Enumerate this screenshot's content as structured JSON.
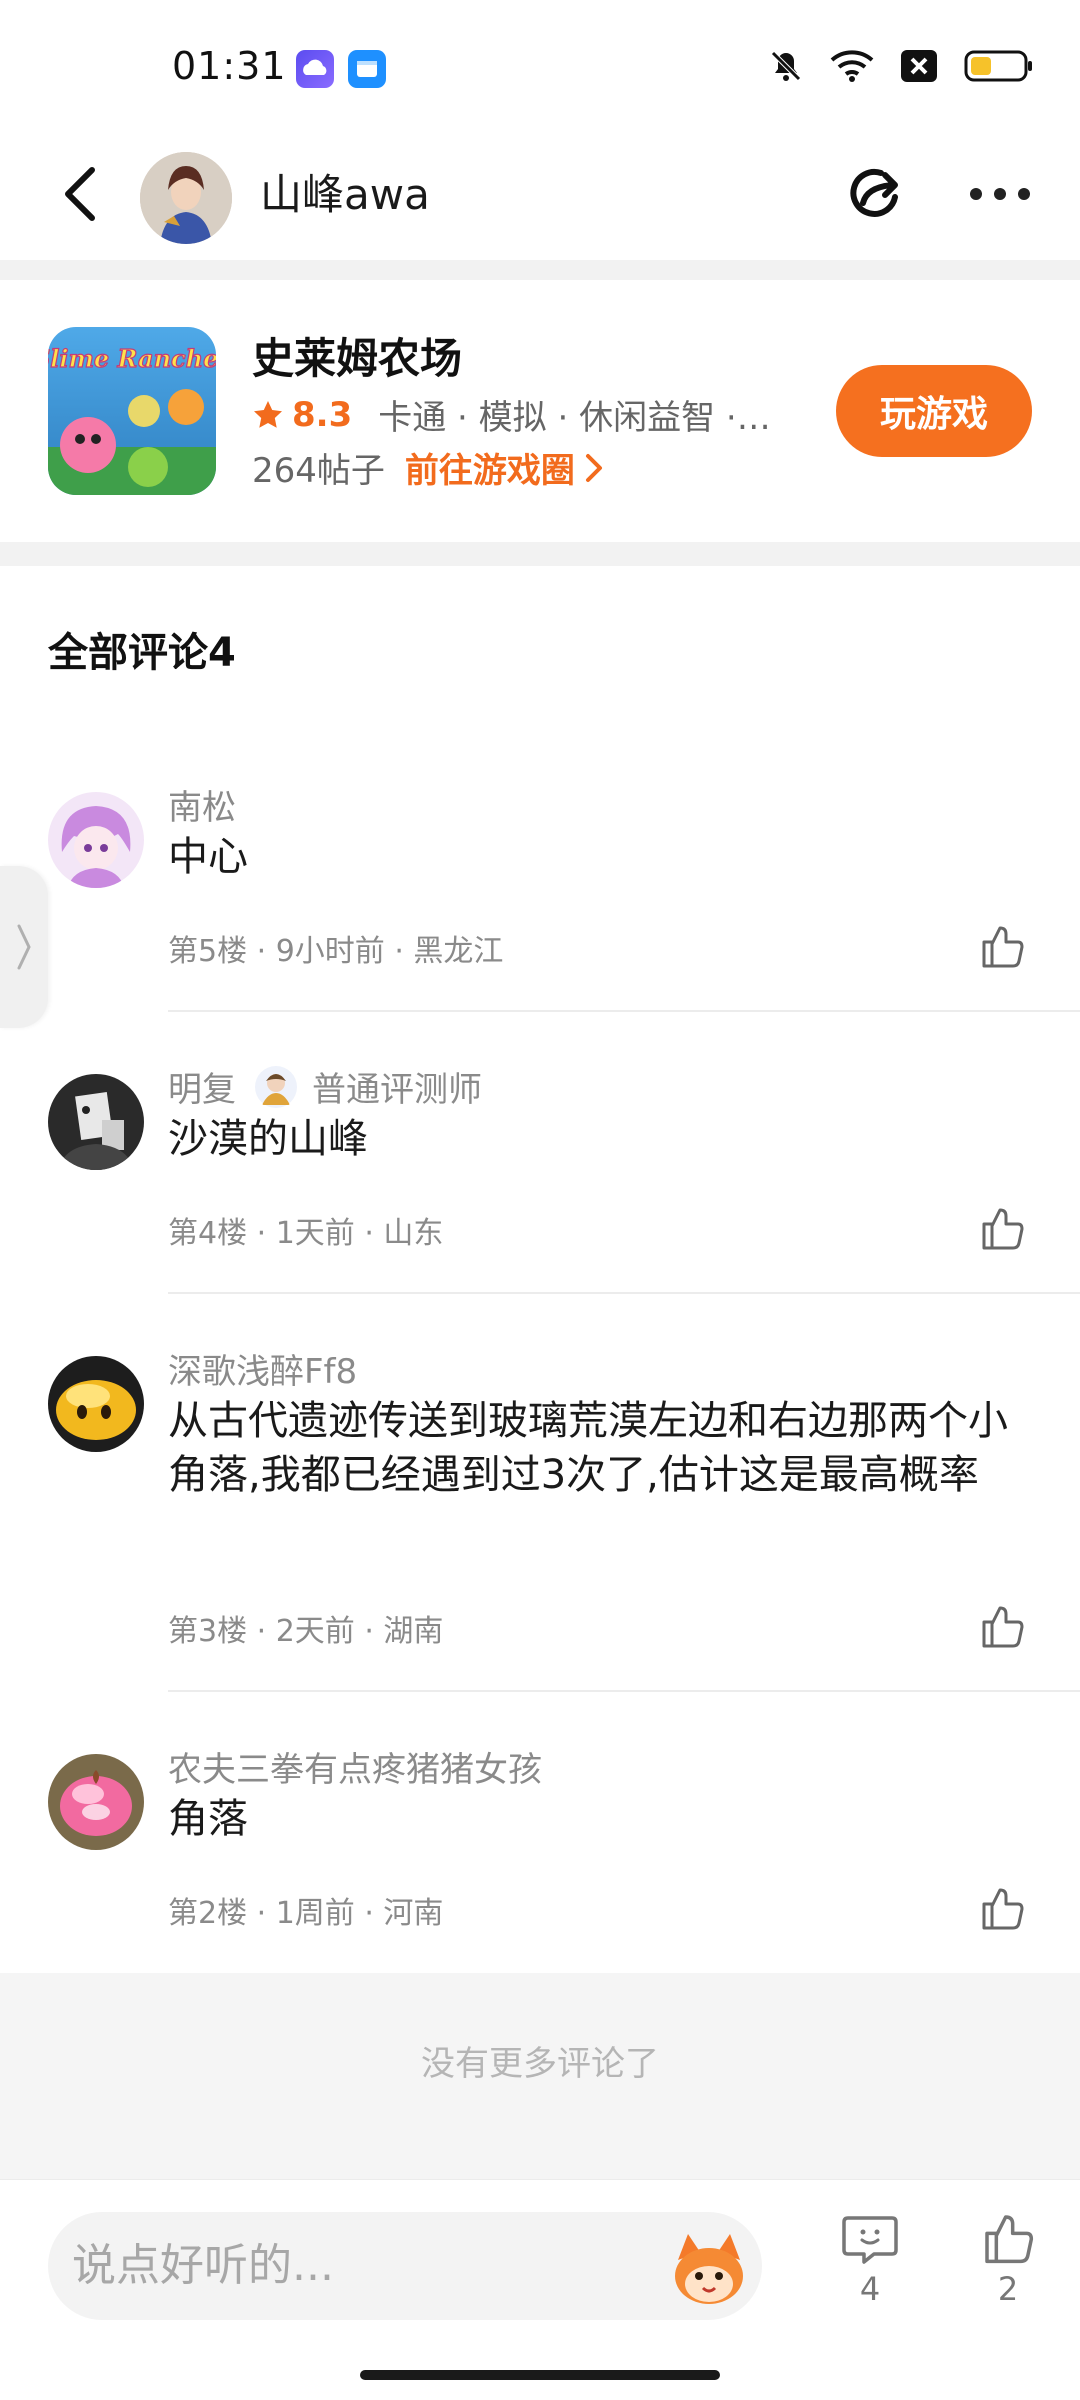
{
  "status_bar": {
    "time": "01:31",
    "icons": [
      "cloud-app-icon",
      "files-app-icon",
      "mute-icon",
      "wifi-icon",
      "close-box-icon",
      "battery-icon"
    ]
  },
  "header": {
    "username": "山峰awa",
    "icons": [
      "back-icon",
      "share-icon",
      "more-icon"
    ]
  },
  "game": {
    "icon_art_text": "Slime Rancher",
    "title": "史莱姆农场",
    "rating": "8.3",
    "tags": "卡通 · 模拟 · 休闲益智 · ...",
    "post_count": "264帖子",
    "goto_label": "前往游戏圈",
    "play_label": "玩游戏"
  },
  "comments": {
    "title": "全部评论4",
    "items": [
      {
        "user": "南松",
        "text": "中心",
        "meta": "第5楼 · 9小时前 · 黑龙江"
      },
      {
        "user": "明复",
        "badge": "普通评测师",
        "text": "沙漠的山峰",
        "meta": "第4楼 · 1天前 · 山东"
      },
      {
        "user": "深歌浅醉Ff8",
        "text": "从古代遗迹传送到玻璃荒漠左边和右边那两个小角落,我都已经遇到过3次了,估计这是最高概率",
        "meta": "第3楼 · 2天前 · 湖南"
      },
      {
        "user": "农夫三拳有点疼猪猪女孩",
        "text": "角落",
        "meta": "第2楼 · 1周前 · 河南"
      }
    ],
    "no_more": "没有更多评论了"
  },
  "bottom_bar": {
    "input_placeholder": "说点好听的...",
    "comment_count": "4",
    "like_count": "2"
  },
  "colors": {
    "accent": "#f5701f",
    "accent_text": "#f26b1d",
    "muted_text": "#8a8a8a",
    "band_bg": "#f2f2f2"
  }
}
